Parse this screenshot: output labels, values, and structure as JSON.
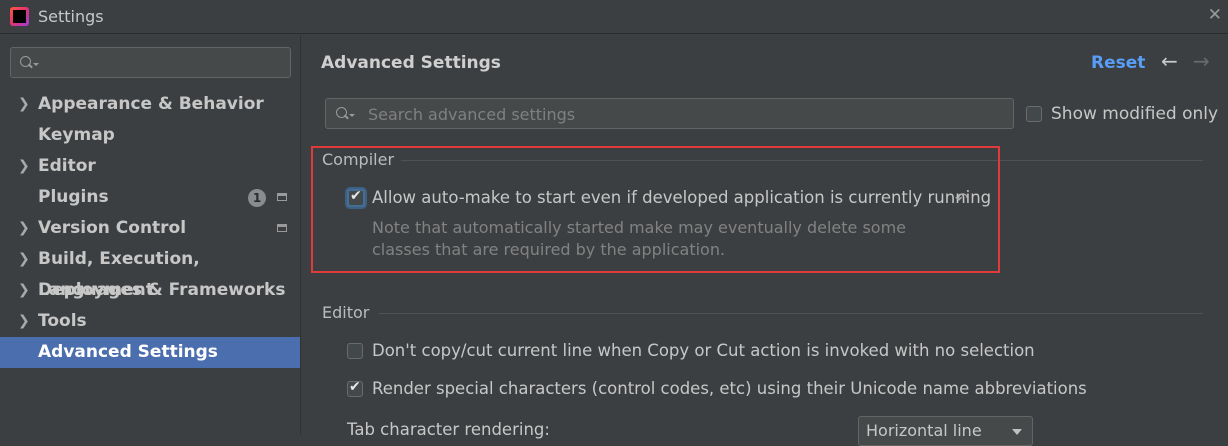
{
  "window": {
    "title": "Settings",
    "close_glyph": "✕"
  },
  "sidebar": {
    "search": {
      "placeholder": ""
    },
    "items": [
      {
        "label": "Appearance & Behavior",
        "expandable": true
      },
      {
        "label": "Keymap",
        "expandable": false
      },
      {
        "label": "Editor",
        "expandable": true
      },
      {
        "label": "Plugins",
        "expandable": false,
        "badge": "1"
      },
      {
        "label": "Version Control",
        "expandable": true
      },
      {
        "label": "Build, Execution, Deployment",
        "expandable": true
      },
      {
        "label": "Languages & Frameworks",
        "expandable": true
      },
      {
        "label": "Tools",
        "expandable": true
      },
      {
        "label": "Advanced Settings",
        "expandable": false,
        "selected": true
      }
    ]
  },
  "main": {
    "title": "Advanced Settings",
    "reset_label": "Reset",
    "nav": {
      "back": "←",
      "forward": "→"
    },
    "search": {
      "placeholder": "Search advanced settings"
    },
    "show_modified_only": {
      "label": "Show modified only",
      "checked": false
    },
    "groups": [
      {
        "title": "Compiler",
        "settings": [
          {
            "label": "Allow auto-make to start even if developed application is currently running",
            "checked": true,
            "note_line1": "Note that automatically started make may eventually delete some",
            "note_line2": "classes that are required by the application."
          }
        ]
      },
      {
        "title": "Editor",
        "settings": [
          {
            "label": "Don't copy/cut current line when Copy or Cut action is invoked with no selection",
            "checked": false
          },
          {
            "label": "Render special characters (control codes, etc) using their Unicode name abbreviations",
            "checked": true
          },
          {
            "label": "Tab character rendering:",
            "value": "Horizontal line"
          }
        ]
      }
    ]
  },
  "colors": {
    "selection": "#4b6eaf",
    "link": "#589df6",
    "highlight_border": "#e03a3a",
    "background": "#3c3f41"
  },
  "icons": {
    "chevron": "chevron-right-icon",
    "undo": "undo-icon",
    "check": "check-icon"
  }
}
